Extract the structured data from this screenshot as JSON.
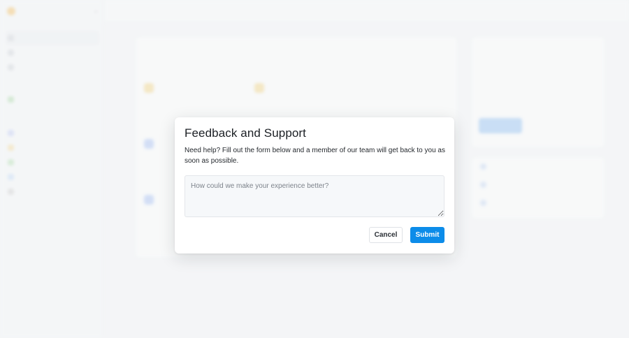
{
  "modal": {
    "title": "Feedback and Support",
    "description": "Need help? Fill out the form below and a member of our team will get back to you as soon as possible.",
    "textarea_placeholder": "How could we make your experience better?",
    "textarea_value": "",
    "cancel_label": "Cancel",
    "submit_label": "Submit"
  },
  "colors": {
    "accent": "#0c8ce9",
    "overlay": "#f4f5f7"
  }
}
